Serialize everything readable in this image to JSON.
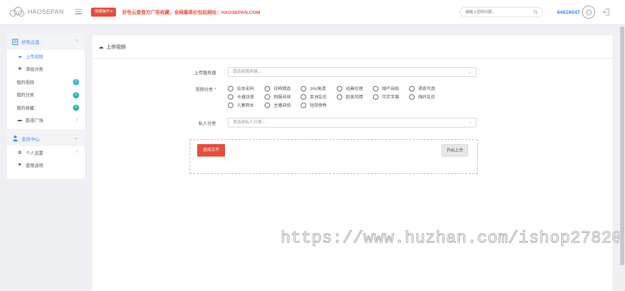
{
  "header": {
    "logo_text": "HAOSEPAN",
    "quick_button": "快捷操作 ▾",
    "announcement": "好色云盘官方广告收藏，全网最高价包站网址：HAOSEPAN.COM",
    "search_placeholder": "请输入您的问题...",
    "user_id": "64618047"
  },
  "sidebar": {
    "group1": {
      "label": "好色云盘",
      "caret": "‹"
    },
    "items": [
      {
        "label": "上传视频",
        "icon": "☁",
        "badge": ""
      },
      {
        "label": "添加分类",
        "icon": "✚",
        "badge": ""
      },
      {
        "label": "我的视频",
        "icon": "",
        "badge": "1"
      },
      {
        "label": "我的分类",
        "icon": "",
        "badge": "0"
      },
      {
        "label": "我的收藏",
        "icon": "",
        "badge": "0"
      },
      {
        "label": "影视广场",
        "icon": "▬",
        "badge": ""
      }
    ],
    "group2": {
      "label": "会员中心",
      "caret": "⌄"
    },
    "items2": [
      {
        "label": "个人设置",
        "icon": "✿"
      },
      {
        "label": "使用说明",
        "icon": "⚑"
      }
    ]
  },
  "panel": {
    "title": "上传视频",
    "server_label": "上传服务器",
    "server_placeholder": "请选择服务器...",
    "category_label": "视频分类",
    "required_mark": "*",
    "categories": [
      "日本无码",
      "日韩精品",
      "JAV高清",
      "经典伦理",
      "国产自拍",
      "诱惑写真",
      "卡通动漫",
      "制服丝袜",
      "亚洲乱伦",
      "欧美风情",
      "中文字幕",
      "强奸乱伦",
      "人妻熟女",
      "主播自拍",
      "短视频秀"
    ],
    "private_label": "私人分类",
    "private_placeholder": "请选择私人分类...",
    "choose_file": "选择文件",
    "start_upload": "开始上传"
  },
  "watermark": "https://www.huzhan.com/ishop27820",
  "colors": {
    "accent_red": "#e74c3c",
    "accent_blue": "#3a8ee6"
  }
}
